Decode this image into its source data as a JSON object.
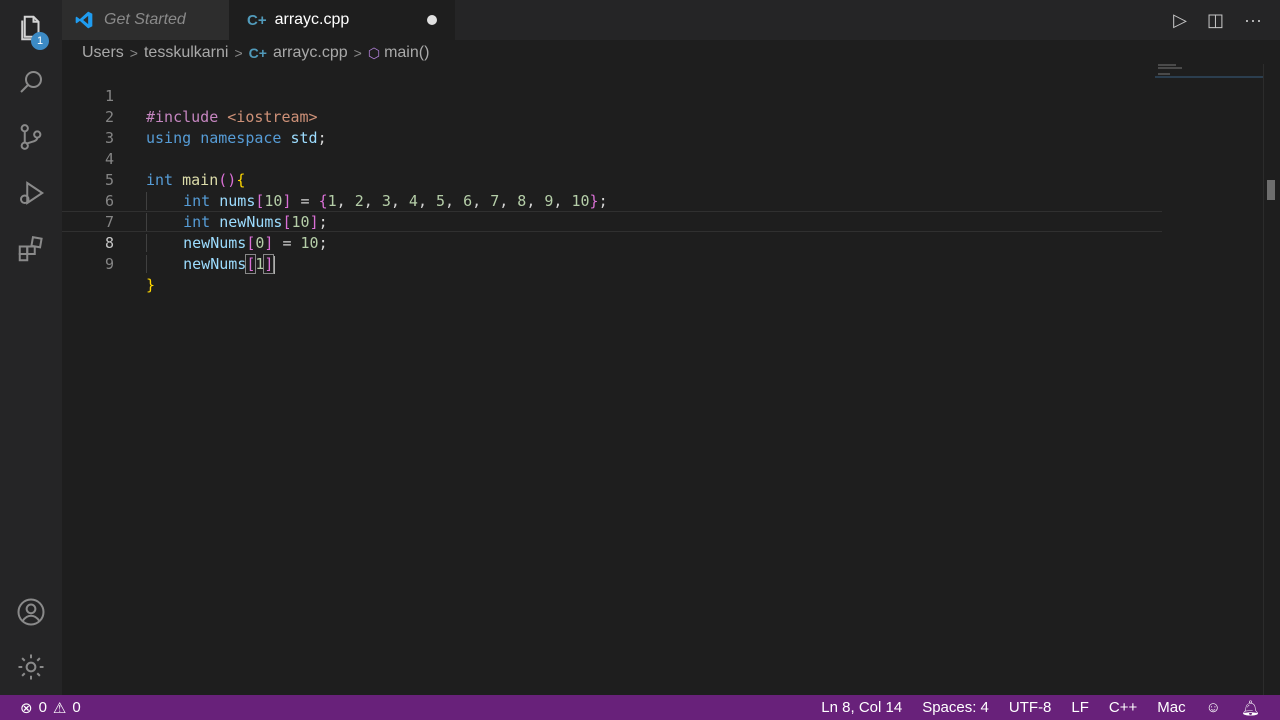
{
  "activity_bar": {
    "explorer_badge": "1",
    "icons": [
      "files-icon",
      "search-icon",
      "source-control-icon",
      "run-debug-icon",
      "extensions-icon",
      "account-icon",
      "gear-icon"
    ]
  },
  "tabs": [
    {
      "label": "Get Started",
      "active": false
    },
    {
      "label": "arrayc.cpp",
      "active": true,
      "dirty": true
    }
  ],
  "tab_actions": {
    "run": "▷",
    "split": "◫",
    "more": "···"
  },
  "breadcrumb": {
    "parts": [
      "Users",
      "tesskulkarni",
      "arrayc.cpp",
      "main()"
    ],
    "separator": ">"
  },
  "editor": {
    "line_numbers": [
      "1",
      "2",
      "3",
      "4",
      "5",
      "6",
      "7",
      "8",
      "9"
    ],
    "current_line": 8,
    "lines": [
      "#include <iostream>",
      "using namespace std;",
      "",
      "int main(){",
      "    int nums[10] = {1, 2, 3, 4, 5, 6, 7, 8, 9, 10};",
      "    int newNums[10];",
      "    newNums[0] = 10;",
      "    newNums[1]",
      "}"
    ]
  },
  "status": {
    "errors": "0",
    "warnings": "0",
    "position": "Ln 8, Col 14",
    "spaces": "Spaces: 4",
    "encoding": "UTF-8",
    "eol": "LF",
    "language": "C++",
    "platform": "Mac"
  },
  "colors": {
    "status_bar": "#68217a",
    "keyword": "#569cd6",
    "preprocessor": "#c586c0",
    "string": "#ce9178",
    "function": "#dcdcaa",
    "variable": "#9cdcfe",
    "number": "#b5cea8"
  }
}
